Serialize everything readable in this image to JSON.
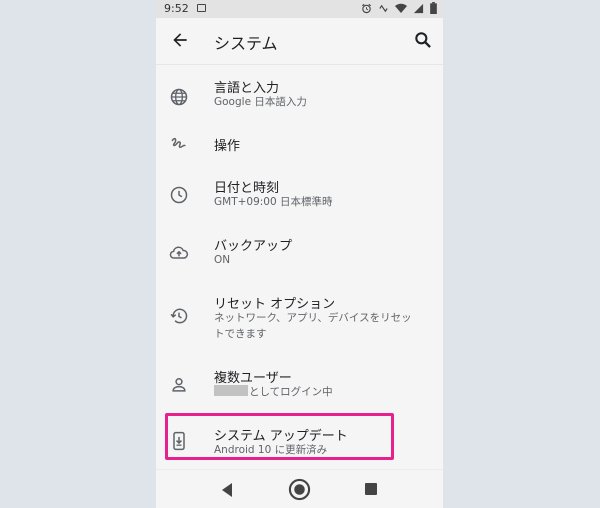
{
  "status_bar": {
    "time": "9:52",
    "icons": [
      "image-icon",
      "alarm-icon",
      "vibrate-icon",
      "wifi-icon",
      "signal-icon",
      "battery-icon"
    ]
  },
  "app_bar": {
    "title": "システム",
    "back_icon": "arrow-back-icon",
    "search_icon": "search-icon"
  },
  "settings": [
    {
      "label": "言語と入力",
      "sub": "Google 日本語入力",
      "icon": "globe-icon"
    },
    {
      "label": "操作",
      "sub": "",
      "icon": "gesture-icon"
    },
    {
      "label": "日付と時刻",
      "sub": "GMT+09:00 日本標準時",
      "icon": "clock-icon"
    },
    {
      "label": "バックアップ",
      "sub": "ON",
      "icon": "cloud-upload-icon"
    },
    {
      "label": "リセット オプション",
      "sub_line1": "ネットワーク、アプリ、デバイスをリセッ",
      "sub_line2": "トできます",
      "icon": "history-icon"
    },
    {
      "label": "複数ユーザー",
      "sub": "としてログイン中",
      "icon": "person-icon"
    },
    {
      "label": "システム アップデート",
      "sub": "Android 10 に更新済み",
      "icon": "system-update-icon"
    }
  ],
  "highlight_color": "#e6218c",
  "nav_bar": {
    "icons": [
      "back-triangle-icon",
      "home-circle-icon",
      "recents-square-icon"
    ]
  }
}
